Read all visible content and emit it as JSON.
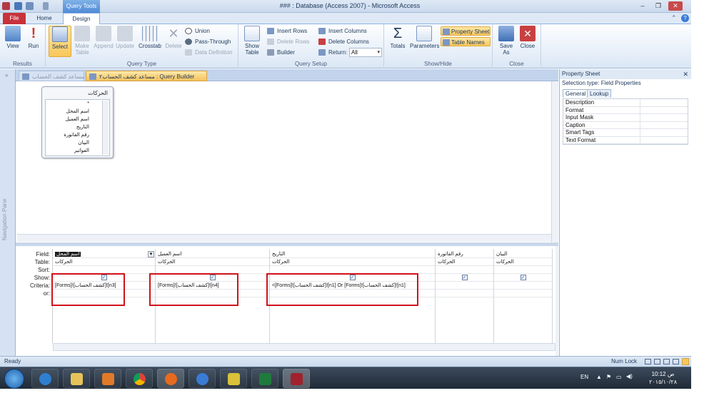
{
  "window": {
    "title": "### : Database (Access 2007) - Microsoft Access",
    "context_tab": "Query Tools",
    "controls": {
      "minimize": "–",
      "restore": "❐",
      "close": "✕"
    }
  },
  "ribbon": {
    "tabs": {
      "file": "File",
      "home": "Home",
      "design": "Design"
    },
    "groups": {
      "results": {
        "label": "Results",
        "view": "View",
        "run": "Run"
      },
      "query_type": {
        "label": "Query Type",
        "select": "Select",
        "make_table": "Make\nTable",
        "append": "Append",
        "update": "Update",
        "crosstab": "Crosstab",
        "delete": "Delete",
        "union": "Union",
        "pass_through": "Pass-Through",
        "data_definition": "Data Definition"
      },
      "query_setup": {
        "label": "Query Setup",
        "show_table": "Show\nTable",
        "insert_rows": "Insert Rows",
        "delete_rows": "Delete Rows",
        "builder": "Builder",
        "insert_columns": "Insert Columns",
        "delete_columns": "Delete Columns",
        "return_label": "Return:",
        "return_value": "All"
      },
      "show_hide": {
        "label": "Show/Hide",
        "totals": "Totals",
        "parameters": "Parameters",
        "property_sheet": "Property Sheet",
        "table_names": "Table Names"
      },
      "close": {
        "label": "Close",
        "save_as": "Save\nAs",
        "close": "Close"
      }
    }
  },
  "nav_pane": {
    "label": "Navigation Pane"
  },
  "doc_tabs": [
    {
      "label": "مساعد كشف الحساب"
    },
    {
      "label": "مساعد كشف الحساب٢ : Query Builder"
    }
  ],
  "table_box": {
    "title": "الحركات",
    "fields": [
      "*",
      "اسم المحل",
      "اسم العميل",
      "التاريخ",
      "رقم الفاتورة",
      "البيان",
      "الفواتير"
    ]
  },
  "grid": {
    "row_labels": [
      "Field:",
      "Table:",
      "Sort:",
      "Show:",
      "Criteria:",
      "or:"
    ],
    "columns": [
      {
        "field": "اسم المحل",
        "table": "الحركات",
        "show": "✓",
        "criteria": "[Forms]![كشف الحساب]![n3]"
      },
      {
        "field": "اسم العميل",
        "table": "الحركات",
        "show": "✓",
        "criteria": "[Forms]![كشف الحساب]![n4]"
      },
      {
        "field": "التاريخ",
        "table": "الحركات",
        "show": "✓",
        "criteria": "<[Forms]![كشف الحساب]![n1] Or [Forms]![كشف الحساب]![n1]"
      },
      {
        "field": "رقم الفاتورة",
        "table": "الحركات",
        "show": "✓",
        "criteria": ""
      },
      {
        "field": "البيان",
        "table": "الحركات",
        "show": "✓",
        "criteria": ""
      }
    ]
  },
  "property_sheet": {
    "title": "Property Sheet",
    "selection_type": "Selection type:  Field Properties",
    "tabs": {
      "general": "General",
      "lookup": "Lookup"
    },
    "properties": [
      "Description",
      "Format",
      "Input Mask",
      "Caption",
      "Smart Tags",
      "Text Format"
    ]
  },
  "status": {
    "left": "Ready",
    "num_lock": "Num Lock"
  },
  "taskbar": {
    "lang": "EN",
    "time": "ص 10:12",
    "date": "٢٠١٥/١٠/٢٨"
  },
  "colors": {
    "file_tab": "#c7323c",
    "highlight": "#f8c75a",
    "criteria_box": "#d0121b"
  }
}
